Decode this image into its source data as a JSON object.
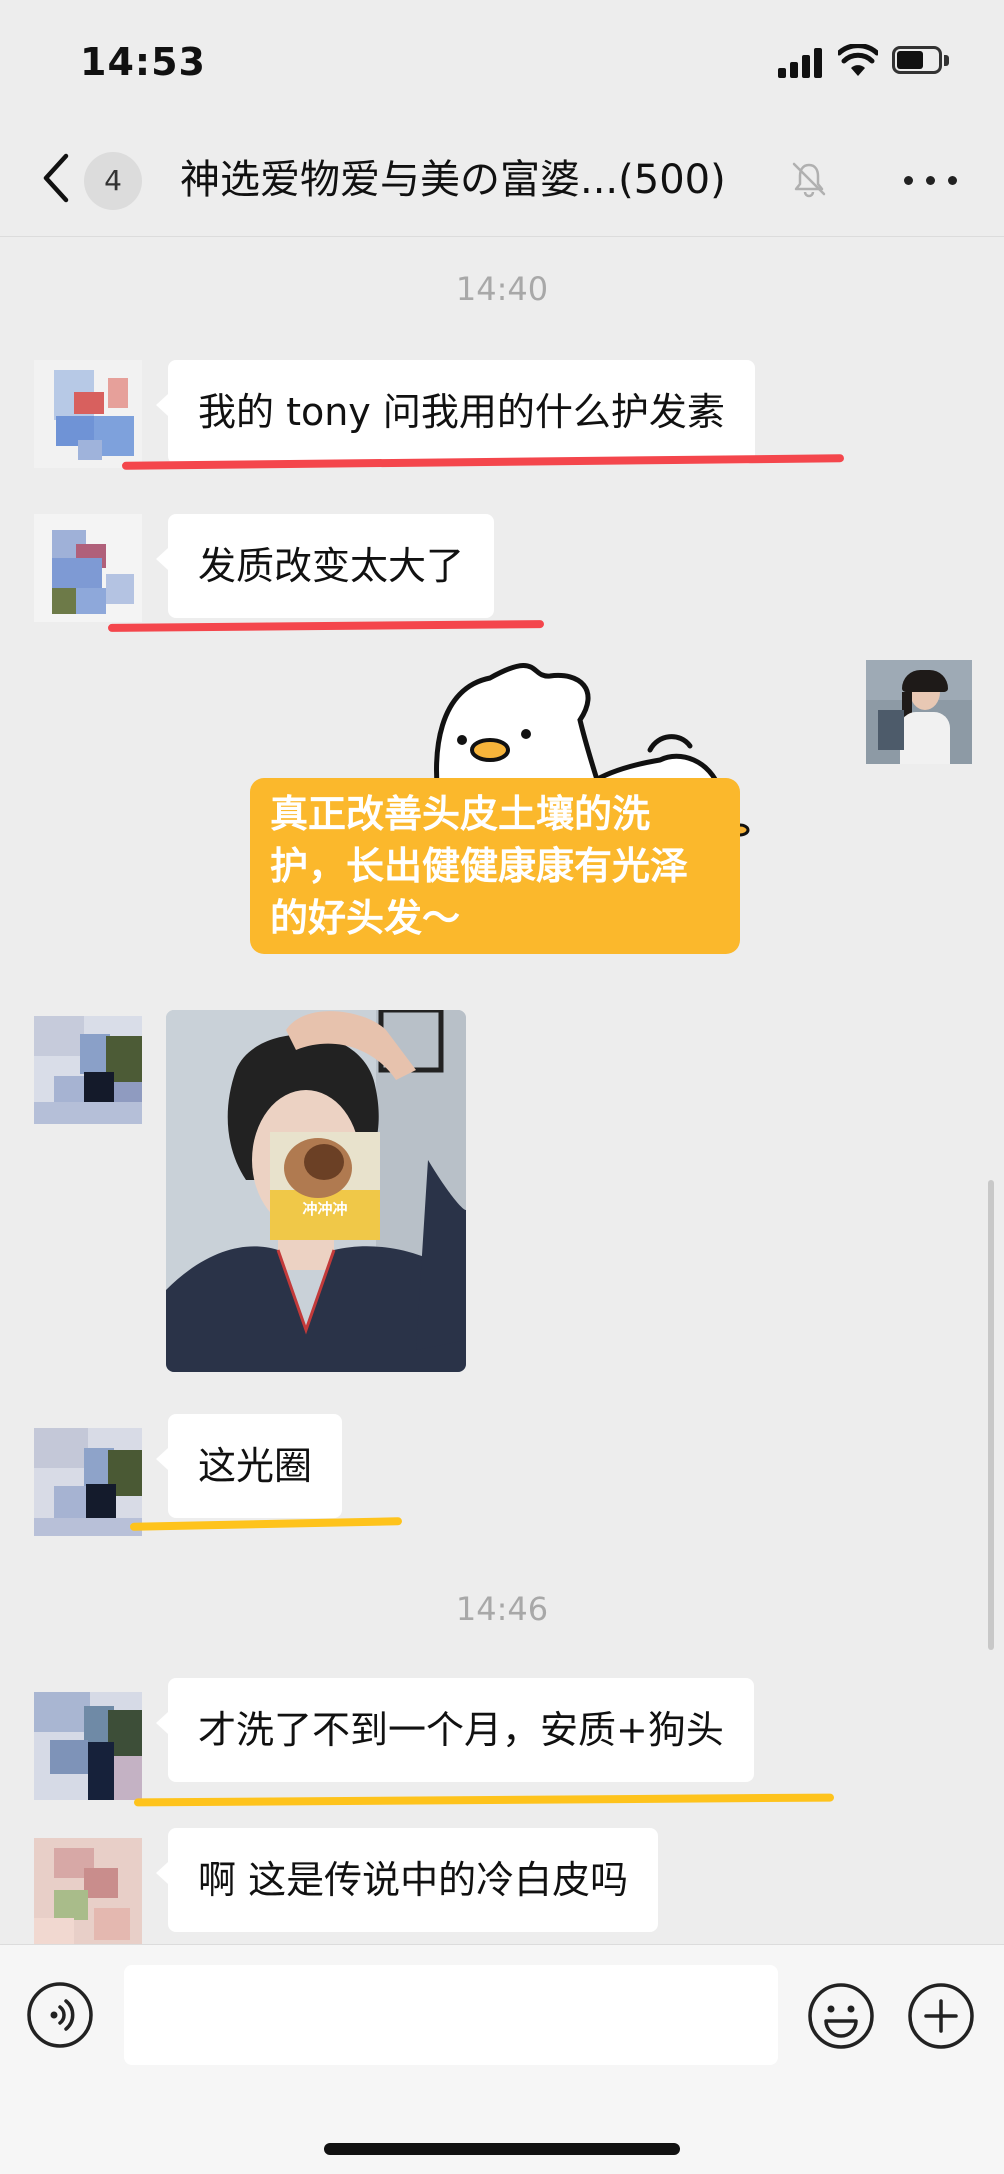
{
  "status_bar": {
    "time": "14:53"
  },
  "nav": {
    "unread_count": "4",
    "title": "神选爱物爱与美の富婆...(500)"
  },
  "messages": {
    "ts1": "14:40",
    "msg1": "我的 tony 问我用的什么护发素",
    "msg2": "发质改变太大了",
    "sticker_caption": "真正改善头皮土壤的洗护，长出健健康康有光泽的好头发～",
    "photo_overlay_text": "冲冲冲",
    "msg4": "这光圈",
    "ts2": "14:46",
    "msg5": "才洗了不到一个月，安质+狗头",
    "msg6": "啊 这是传说中的冷白皮吗"
  },
  "input_bar": {
    "placeholder": ""
  },
  "colors": {
    "highlight_red": "#f4464c",
    "highlight_yellow": "#fec31c",
    "sticker_bg": "#fbb82c",
    "chat_bg": "#ededed"
  },
  "icons": [
    "back-chevron-icon",
    "mute-bell-icon",
    "more-dots-icon",
    "voice-icon",
    "emoji-icon",
    "plus-icon",
    "signal-icon",
    "wifi-icon",
    "battery-icon"
  ]
}
